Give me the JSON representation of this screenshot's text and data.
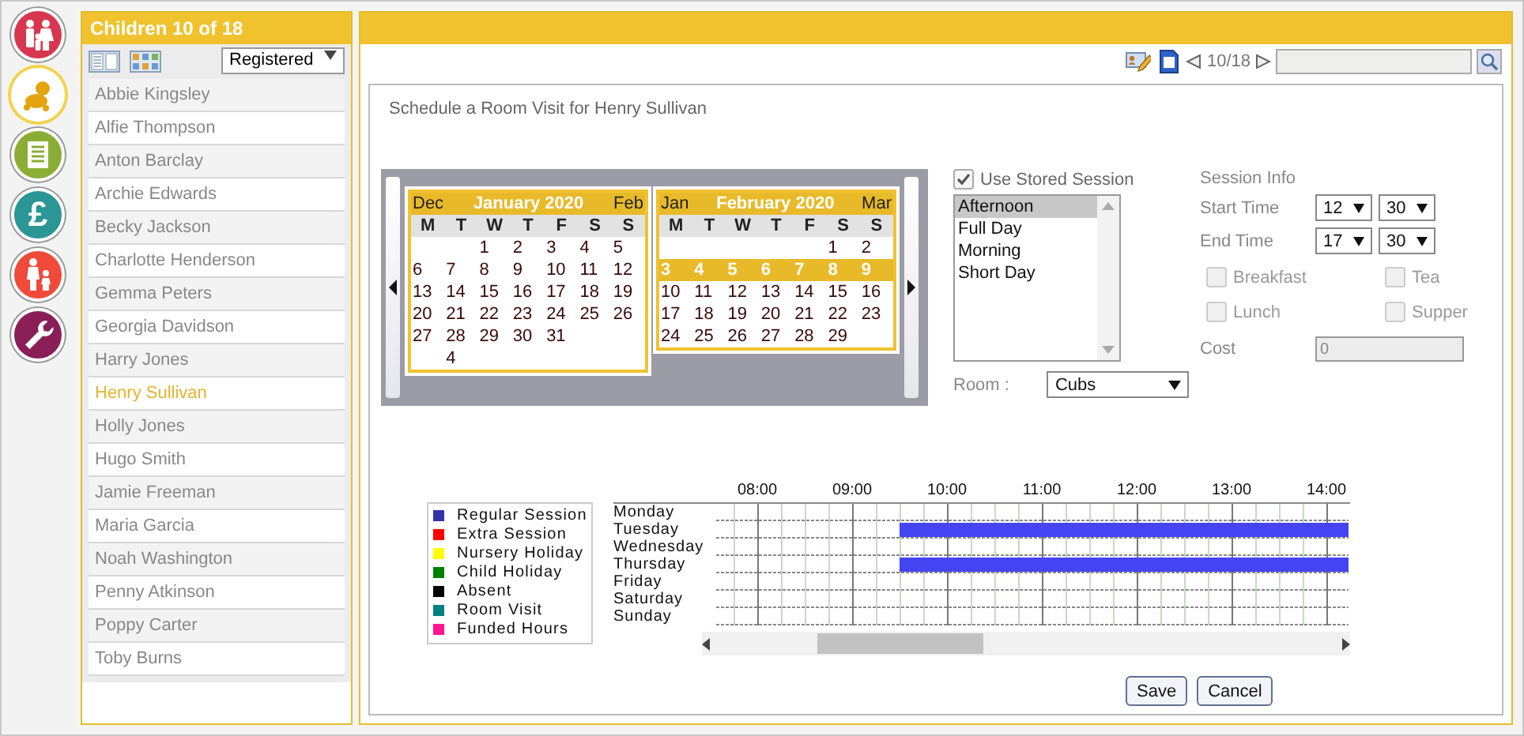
{
  "nav": [
    {
      "kind": "family",
      "color": "#d8364f",
      "selected": false
    },
    {
      "kind": "baby",
      "color": "#e5a310",
      "selected": true
    },
    {
      "kind": "notes",
      "color": "#8aae35",
      "selected": false
    },
    {
      "kind": "pound",
      "color": "#2a9696",
      "selected": false,
      "glyph": "£"
    },
    {
      "kind": "parent",
      "color": "#ef4a3a",
      "selected": false
    },
    {
      "kind": "wrench",
      "color": "#8a1f58",
      "selected": false
    }
  ],
  "sidebar": {
    "title": "Children 10 of 18",
    "filter": "Registered",
    "children": [
      {
        "name": "Abbie Kingsley",
        "selected": false
      },
      {
        "name": "Alfie Thompson",
        "selected": false
      },
      {
        "name": "Anton Barclay",
        "selected": false
      },
      {
        "name": "Archie Edwards",
        "selected": false
      },
      {
        "name": "Becky Jackson",
        "selected": false
      },
      {
        "name": "Charlotte Henderson",
        "selected": false
      },
      {
        "name": "Gemma Peters",
        "selected": false
      },
      {
        "name": "Georgia Davidson",
        "selected": false
      },
      {
        "name": "Harry Jones",
        "selected": false
      },
      {
        "name": "Henry Sullivan",
        "selected": true
      },
      {
        "name": "Holly Jones",
        "selected": false
      },
      {
        "name": "Hugo Smith",
        "selected": false
      },
      {
        "name": "Jamie Freeman",
        "selected": false
      },
      {
        "name": "Maria Garcia",
        "selected": false
      },
      {
        "name": "Noah Washington",
        "selected": false
      },
      {
        "name": "Penny Atkinson",
        "selected": false
      },
      {
        "name": "Poppy Carter",
        "selected": false
      },
      {
        "name": "Toby Burns",
        "selected": false
      }
    ]
  },
  "toolbar": {
    "page": "10/18"
  },
  "form": {
    "title": "Schedule a Room Visit for Henry Sullivan",
    "calendars": [
      {
        "prev": "Dec",
        "title": "January 2020",
        "next": "Feb",
        "weekdays": [
          "M",
          "T",
          "W",
          "T",
          "F",
          "S",
          "S"
        ],
        "weeks": [
          {
            "days": [
              {
                "kind": "blank"
              },
              {
                "kind": "blank"
              },
              {
                "kind": "date",
                "text": "1"
              },
              {
                "kind": "date",
                "text": "2"
              },
              {
                "kind": "date",
                "text": "3"
              },
              {
                "kind": "date",
                "text": "4"
              },
              {
                "kind": "date",
                "text": "5"
              }
            ],
            "selected": false
          },
          {
            "days": [
              {
                "kind": "date",
                "text": "6"
              },
              {
                "kind": "date",
                "text": "7"
              },
              {
                "kind": "date",
                "text": "8"
              },
              {
                "kind": "date",
                "text": "9"
              },
              {
                "kind": "date",
                "text": "10"
              },
              {
                "kind": "date",
                "text": "11"
              },
              {
                "kind": "date",
                "text": "12"
              }
            ],
            "selected": false
          },
          {
            "days": [
              {
                "kind": "date",
                "text": "13"
              },
              {
                "kind": "date",
                "text": "14"
              },
              {
                "kind": "date",
                "text": "15"
              },
              {
                "kind": "date",
                "text": "16"
              },
              {
                "kind": "date",
                "text": "17"
              },
              {
                "kind": "date",
                "text": "18"
              },
              {
                "kind": "date",
                "text": "19"
              }
            ],
            "selected": false
          },
          {
            "days": [
              {
                "kind": "date",
                "text": "20"
              },
              {
                "kind": "date",
                "text": "21"
              },
              {
                "kind": "date",
                "text": "22"
              },
              {
                "kind": "date",
                "text": "23"
              },
              {
                "kind": "date",
                "text": "24"
              },
              {
                "kind": "date",
                "text": "25"
              },
              {
                "kind": "date",
                "text": "26"
              }
            ],
            "selected": false
          },
          {
            "days": [
              {
                "kind": "date",
                "text": "27"
              },
              {
                "kind": "date",
                "text": "28"
              },
              {
                "kind": "date",
                "text": "29"
              },
              {
                "kind": "date",
                "text": "30"
              },
              {
                "kind": "date",
                "text": "31"
              }
            ],
            "selected": false
          },
          {
            "days": [
              {
                "kind": "blank"
              },
              {
                "kind": "date",
                "text": "4"
              }
            ],
            "selected": false
          }
        ]
      },
      {
        "prev": "Jan",
        "title": "February 2020",
        "next": "Mar",
        "weekdays": [
          "M",
          "T",
          "W",
          "T",
          "F",
          "S",
          "S"
        ],
        "weeks": [
          {
            "days": [
              {
                "kind": "blank"
              },
              {
                "kind": "blank"
              },
              {
                "kind": "blank"
              },
              {
                "kind": "blank"
              },
              {
                "kind": "blank"
              },
              {
                "kind": "date",
                "text": "1"
              },
              {
                "kind": "date",
                "text": "2"
              }
            ],
            "selected": false
          },
          {
            "days": [
              {
                "kind": "date",
                "text": "3"
              },
              {
                "kind": "date",
                "text": "4"
              },
              {
                "kind": "date",
                "text": "5"
              },
              {
                "kind": "date",
                "text": "6"
              },
              {
                "kind": "date",
                "text": "7"
              },
              {
                "kind": "date",
                "text": "8"
              },
              {
                "kind": "date",
                "text": "9"
              }
            ],
            "selected": true
          },
          {
            "days": [
              {
                "kind": "date",
                "text": "10"
              },
              {
                "kind": "date",
                "text": "11"
              },
              {
                "kind": "date",
                "text": "12"
              },
              {
                "kind": "date",
                "text": "13"
              },
              {
                "kind": "date",
                "text": "14"
              },
              {
                "kind": "date",
                "text": "15"
              },
              {
                "kind": "date",
                "text": "16"
              }
            ],
            "selected": false
          },
          {
            "days": [
              {
                "kind": "date",
                "text": "17"
              },
              {
                "kind": "date",
                "text": "18"
              },
              {
                "kind": "date",
                "text": "19"
              },
              {
                "kind": "date",
                "text": "20"
              },
              {
                "kind": "date",
                "text": "21"
              },
              {
                "kind": "date",
                "text": "22"
              },
              {
                "kind": "date",
                "text": "23"
              }
            ],
            "selected": false
          },
          {
            "days": [
              {
                "kind": "date",
                "text": "24"
              },
              {
                "kind": "date",
                "text": "25"
              },
              {
                "kind": "date",
                "text": "26"
              },
              {
                "kind": "date",
                "text": "27"
              },
              {
                "kind": "date",
                "text": "28"
              },
              {
                "kind": "date",
                "text": "29"
              }
            ],
            "selected": false
          }
        ]
      }
    ],
    "stored_session": {
      "label": "Use Stored Session",
      "checked": true,
      "sessions": [
        {
          "name": "Afternoon",
          "selected": true
        },
        {
          "name": "Full Day",
          "selected": false
        },
        {
          "name": "Morning",
          "selected": false
        },
        {
          "name": "Short Day",
          "selected": false
        }
      ]
    },
    "room": {
      "label": "Room :",
      "value": "Cubs"
    },
    "session_info": {
      "title": "Session Info",
      "times": [
        {
          "label": "Start Time",
          "hour": "12",
          "minute": "30"
        },
        {
          "label": "End Time",
          "hour": "17",
          "minute": "30"
        }
      ],
      "meals": [
        {
          "label": "Breakfast",
          "checked": false,
          "disabled": true
        },
        {
          "label": "Tea",
          "checked": false,
          "disabled": true
        },
        {
          "label": "Lunch",
          "checked": false,
          "disabled": true
        },
        {
          "label": "Supper",
          "checked": false,
          "disabled": true
        }
      ],
      "cost": {
        "label": "Cost",
        "value": "0",
        "disabled": true
      }
    },
    "legend": [
      {
        "label": "Regular Session",
        "color": "#3333aa"
      },
      {
        "label": "Extra Session",
        "color": "#ff0000"
      },
      {
        "label": "Nursery Holiday",
        "color": "#ffff00"
      },
      {
        "label": "Child Holiday",
        "color": "#008000"
      },
      {
        "label": "Absent",
        "color": "#000000"
      },
      {
        "label": "Room Visit",
        "color": "#008080"
      },
      {
        "label": "Funded Hours",
        "color": "#ff1493"
      }
    ],
    "timeline": {
      "hours": [
        "08:00",
        "09:00",
        "10:00",
        "11:00",
        "12:00",
        "13:00",
        "14:00"
      ],
      "days": [
        {
          "name": "Monday"
        },
        {
          "name": "Tuesday",
          "level": 0.71
        },
        {
          "name": "Wednesday"
        },
        {
          "name": "Thursday",
          "level": 0.71
        },
        {
          "name": "Friday"
        },
        {
          "name": "Saturday"
        },
        {
          "name": "Sunday"
        }
      ]
    },
    "buttons": [
      "Save",
      "Cancel"
    ]
  }
}
